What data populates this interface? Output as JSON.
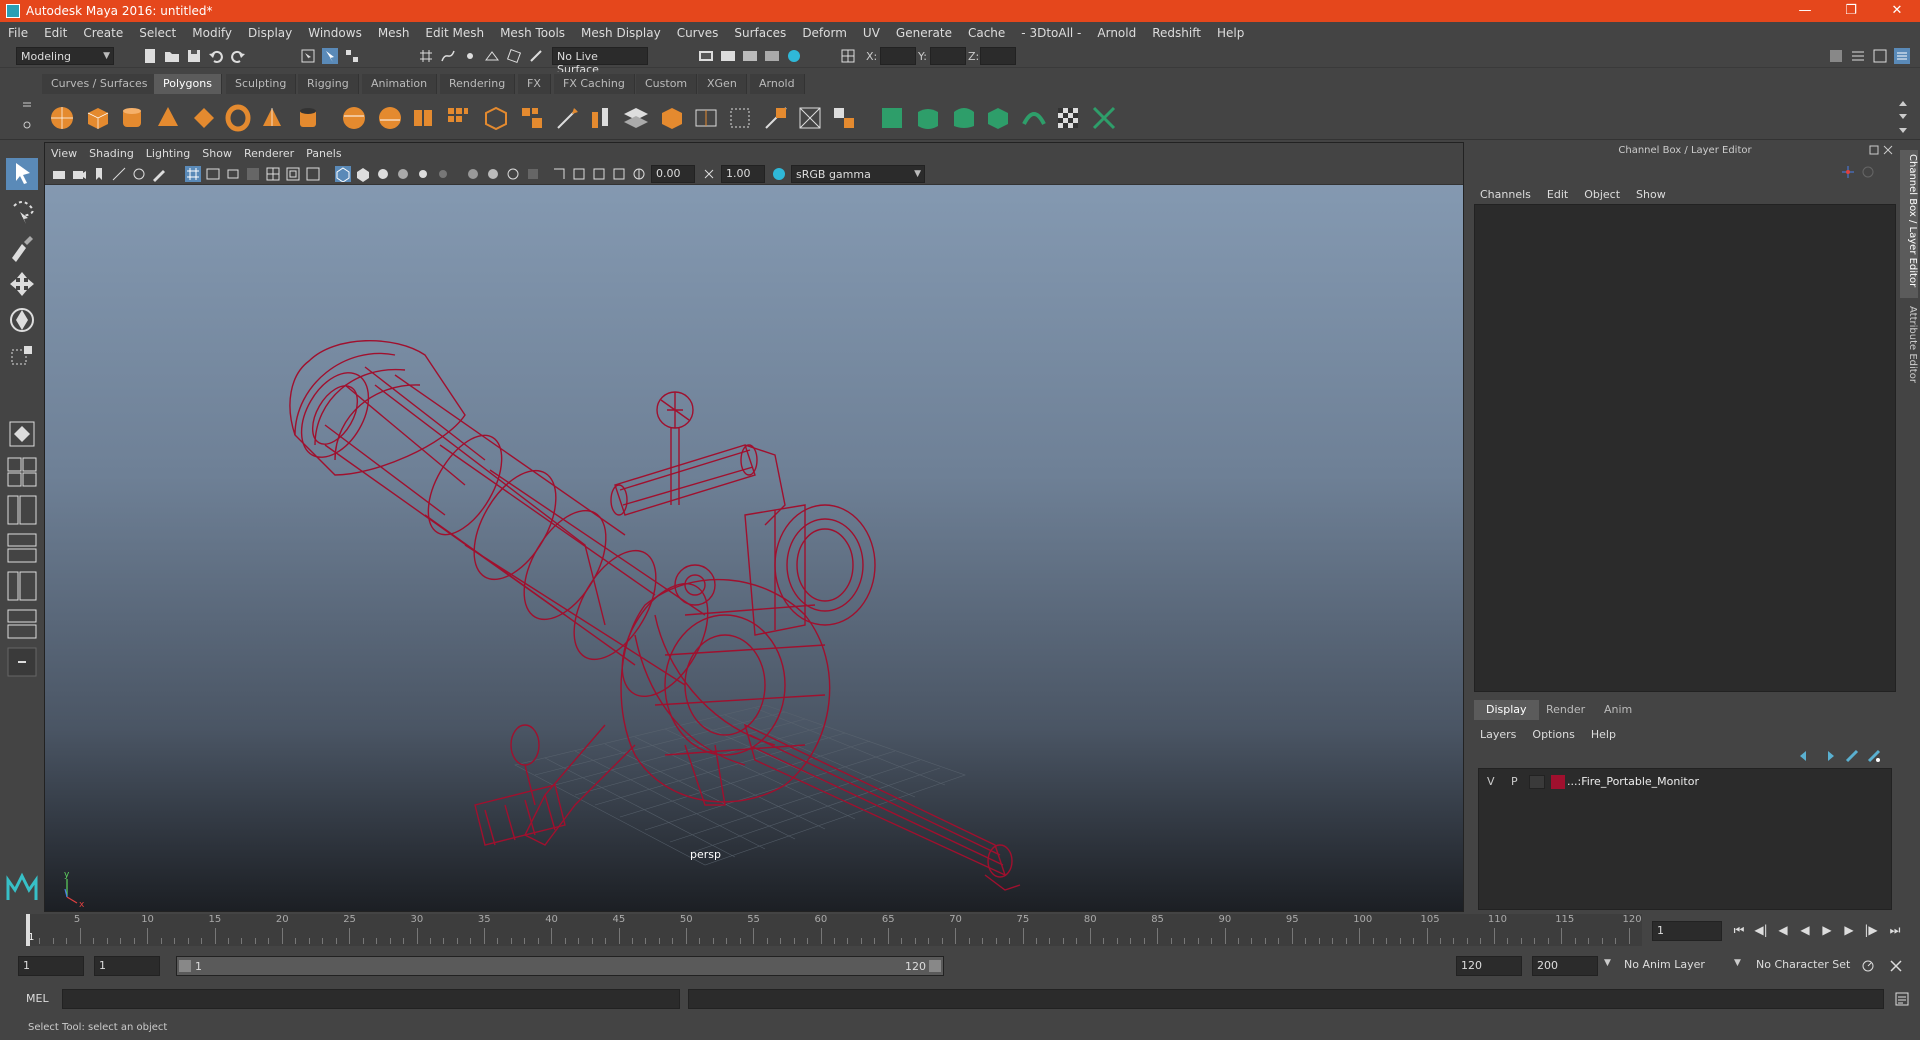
{
  "window": {
    "title": "Autodesk Maya 2016: untitled*"
  },
  "menubar": [
    "File",
    "Edit",
    "Create",
    "Select",
    "Modify",
    "Display",
    "Windows",
    "Mesh",
    "Edit Mesh",
    "Mesh Tools",
    "Mesh Display",
    "Curves",
    "Surfaces",
    "Deform",
    "UV",
    "Generate",
    "Cache",
    "- 3DtoAll -",
    "Arnold",
    "Redshift",
    "Help"
  ],
  "statusline": {
    "mode": "Modeling",
    "live_surface": "No Live Surface",
    "x_label": "X:",
    "y_label": "Y:",
    "z_label": "Z:"
  },
  "shelf": {
    "tabs": [
      "Curves / Surfaces",
      "Polygons",
      "Sculpting",
      "Rigging",
      "Animation",
      "Rendering",
      "FX",
      "FX Caching",
      "Custom",
      "XGen",
      "Arnold"
    ],
    "active_tab": "Polygons"
  },
  "viewport": {
    "menu": [
      "View",
      "Shading",
      "Lighting",
      "Show",
      "Renderer",
      "Panels"
    ],
    "exposure": "0.00",
    "gamma": "1.00",
    "colorspace": "sRGB gamma",
    "camera_label": "persp"
  },
  "channelbox": {
    "title": "Channel Box / Layer Editor",
    "menu": [
      "Channels",
      "Edit",
      "Object",
      "Show"
    ],
    "layer_tabs": [
      "Display",
      "Render",
      "Anim"
    ],
    "layer_menu": [
      "Layers",
      "Options",
      "Help"
    ],
    "layer": {
      "v": "V",
      "p": "P",
      "name": "...:Fire_Portable_Monitor",
      "color": "#a0102e"
    }
  },
  "sidetabs": [
    "Channel Box / Layer Editor",
    "Attribute Editor"
  ],
  "timeslider": {
    "ticks": [
      "5",
      "10",
      "15",
      "20",
      "25",
      "30",
      "35",
      "40",
      "45",
      "50",
      "55",
      "60",
      "65",
      "70",
      "75",
      "80",
      "85",
      "90",
      "95",
      "100",
      "105",
      "110",
      "115",
      "120"
    ],
    "start": "1",
    "current_frame": "1"
  },
  "rangeslider": {
    "start": "1",
    "playback_start": "1",
    "range_start": "1",
    "range_end": "120",
    "playback_end": "120",
    "end": "200",
    "anim_layer": "No Anim Layer",
    "character_set": "No Character Set"
  },
  "cmdline": {
    "label": "MEL"
  },
  "helpline": {
    "text": "Select Tool: select an object"
  },
  "colors": {
    "title_bar": "#e5471c",
    "wireframe": "#a0102e"
  }
}
